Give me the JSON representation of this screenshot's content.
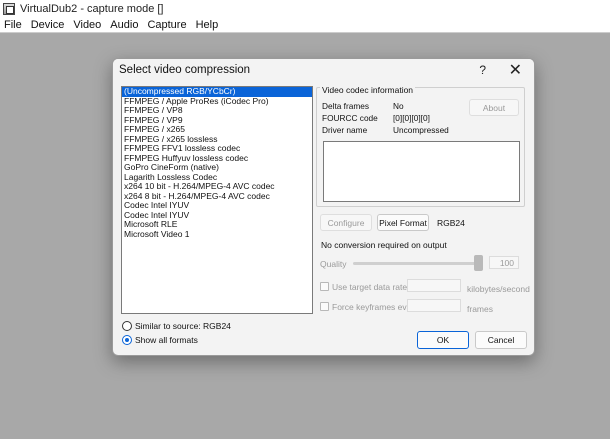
{
  "window": {
    "title": "VirtualDub2 - capture mode []",
    "menu": [
      "File",
      "Device",
      "Video",
      "Audio",
      "Capture",
      "Help"
    ]
  },
  "dialog": {
    "title": "Select video compression",
    "help_glyph": "?",
    "close_glyph": "✕",
    "codecs": [
      "(Uncompressed RGB/YCbCr)",
      "FFMPEG / Apple ProRes (iCodec Pro)",
      "FFMPEG / VP8",
      "FFMPEG / VP9",
      "FFMPEG / x265",
      "FFMPEG / x265 lossless",
      "FFMPEG FFV1 lossless codec",
      "FFMPEG Huffyuv lossless codec",
      "GoPro CineForm (native)",
      "Lagarith Lossless Codec",
      "x264 10 bit - H.264/MPEG-4 AVC codec",
      "x264 8 bit - H.264/MPEG-4 AVC codec",
      "Codec Intel IYUV",
      "Codec Intel IYUV",
      "Microsoft RLE",
      "Microsoft Video 1"
    ],
    "selected_index": 0,
    "radio_similar": "Similar to source: RGB24",
    "radio_all": "Show all formats",
    "radio_selected": "all",
    "codec_info": {
      "group_title": "Video codec information",
      "delta_label": "Delta frames",
      "delta_value": "No",
      "fourcc_label": "FOURCC code",
      "fourcc_value": "[0][0][0][0]",
      "driver_label": "Driver name",
      "driver_value": "Uncompressed",
      "about_button": "About"
    },
    "configure_button": "Configure",
    "pixel_format_button": "Pixel Format",
    "pixel_format_value": "RGB24",
    "conversion_note": "No conversion required on output",
    "quality_label": "Quality",
    "quality_value": "100",
    "quality_level": 1.0,
    "target_rate_label": "Use target data rate of",
    "target_rate_unit": "kilobytes/second",
    "force_keyframes_label": "Force keyframes every",
    "force_keyframes_unit": "frames",
    "ok_button": "OK",
    "cancel_button": "Cancel"
  }
}
